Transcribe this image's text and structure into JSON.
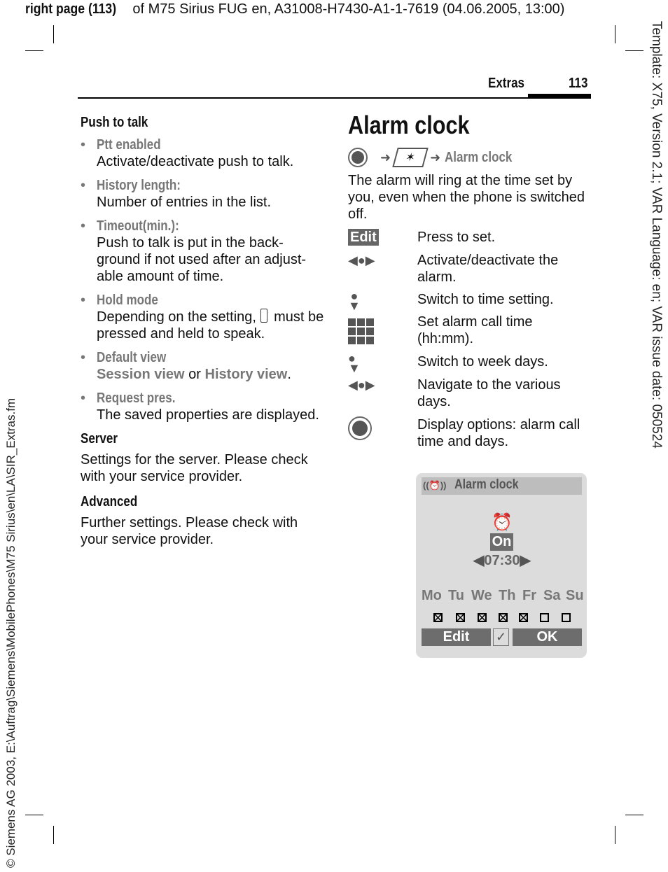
{
  "header": {
    "bold": "right page (113)",
    "rest": " of M75 Sirius FUG en, A31008-H7430-A1-1-7619 (04.06.2005, 13:00)"
  },
  "side_right": "Template: X75, Version 2.1; VAR Language: en; VAR issue date: 050524",
  "side_left": "© Siemens AG 2003, E:\\Auftrag\\Siemens\\MobilePhones\\M75 Sirius\\en\\LA\\SIR_Extras.fm",
  "running_head": {
    "section": "Extras",
    "page": "113"
  },
  "left": {
    "ptt_heading": "Push to talk",
    "items": [
      {
        "title": "Ptt enabled",
        "text": "Activate/deactivate push to talk."
      },
      {
        "title": "History length:",
        "text": "Number of entries in the list."
      },
      {
        "title": "Timeout(min.):",
        "text": "Push to talk is put in the back-ground if not used after an adjust-able amount of time."
      },
      {
        "title": "Hold mode",
        "text_before": "Depending on the setting, ",
        "text_after": " must be pressed and held to speak."
      },
      {
        "title": "Default view",
        "opt1": "Session view",
        "or": " or ",
        "opt2": "History view",
        "end": "."
      },
      {
        "title": "Request pres.",
        "text": "The saved properties are displayed."
      }
    ],
    "server_heading": "Server",
    "server_text": "Settings for the server. Please check with your service provider.",
    "advanced_heading": "Advanced",
    "advanced_text": "Further settings. Please check with your service provider."
  },
  "right": {
    "title": "Alarm clock",
    "path_label": "Alarm clock",
    "intro": "The alarm will ring at the time set by you, even when the phone is switched off.",
    "edit_key": "Edit",
    "rows": [
      {
        "icon": "edit-softkey",
        "text": "Press to set."
      },
      {
        "icon": "nav-left-right-icon",
        "text": "Activate/deactivate the alarm."
      },
      {
        "icon": "nav-down-icon",
        "text": "Switch to time setting."
      },
      {
        "icon": "keypad-icon",
        "text": "Set alarm call time (hh:mm)."
      },
      {
        "icon": "nav-down-icon",
        "text": "Switch to week days."
      },
      {
        "icon": "nav-left-right-icon",
        "text": "Navigate to the various days."
      },
      {
        "icon": "center-key-icon",
        "text": "Display options: alarm call time and days."
      }
    ]
  },
  "phone": {
    "title": "Alarm clock",
    "status": "On",
    "time": "07:30",
    "days": [
      "Mo",
      "Tu",
      "We",
      "Th",
      "Fr",
      "Sa",
      "Su"
    ],
    "checked": [
      true,
      true,
      true,
      true,
      true,
      false,
      false
    ],
    "softkey_left": "Edit",
    "softkey_right": "OK"
  }
}
